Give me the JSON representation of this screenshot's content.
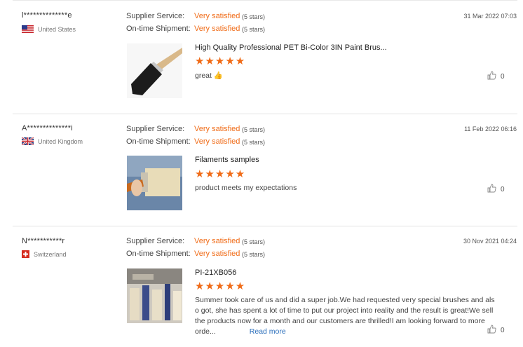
{
  "reviews": [
    {
      "buyer": "l**************e",
      "country": "United States",
      "flag": "us-flag",
      "supplier_service_label": "Supplier Service:",
      "supplier_service_value": "Very satisfied",
      "supplier_service_stars": "(5 stars)",
      "shipment_label": "On-time Shipment:",
      "shipment_value": "Very satisfied",
      "shipment_stars": "(5 stars)",
      "date": "31 Mar 2022 07:03",
      "product": "High Quality Professional PET Bi-Color 3IN Paint Brus...",
      "rating": 5,
      "comment": "great 👍",
      "likes": "0"
    },
    {
      "buyer": "A**************i",
      "country": "United Kingdom",
      "flag": "uk-flag",
      "supplier_service_label": "Supplier Service:",
      "supplier_service_value": "Very satisfied",
      "supplier_service_stars": "(5 stars)",
      "shipment_label": "On-time Shipment:",
      "shipment_value": "Very satisfied",
      "shipment_stars": "(5 stars)",
      "date": "11 Feb 2022 06:16",
      "product": "Filaments samples",
      "rating": 5,
      "comment": "product meets my expectations",
      "likes": "0"
    },
    {
      "buyer": "N***********r",
      "country": "Switzerland",
      "flag": "swiss-flag",
      "supplier_service_label": "Supplier Service:",
      "supplier_service_value": "Very satisfied",
      "supplier_service_stars": "(5 stars)",
      "shipment_label": "On-time Shipment:",
      "shipment_value": "Very satisfied",
      "shipment_stars": "(5 stars)",
      "date": "30 Nov 2021 04:24",
      "product": "PI-21XB056",
      "rating": 5,
      "comment_lines": [
        "Summer took care of us and did a super job.We had requested very special brushes and als",
        "o got, she has spent a lot of time to put our project into reality and the result is great!We sell",
        "the products now for a month and our customers are thrilled!I am looking forward to more",
        "orde..."
      ],
      "read_more": "Read more",
      "likes": "0"
    }
  ],
  "colors": {
    "accent": "#f06b17",
    "link": "#2a6ebb",
    "divider": "#e3e3e3"
  }
}
